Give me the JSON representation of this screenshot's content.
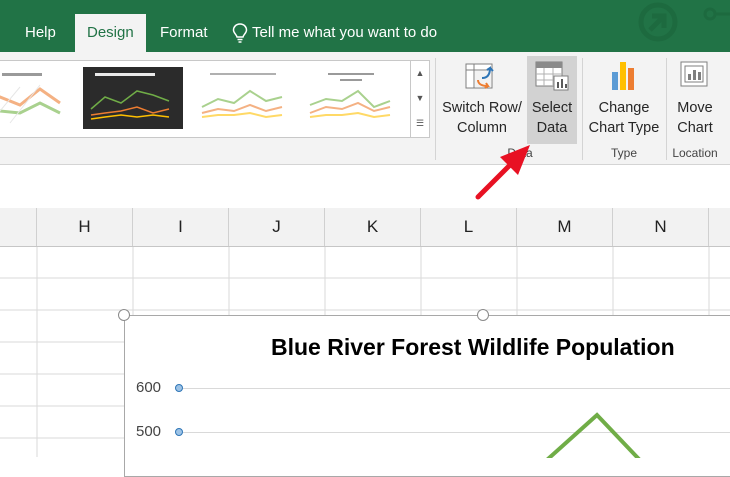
{
  "tabs": [
    {
      "label": "Help",
      "active": false
    },
    {
      "label": "Design",
      "active": true
    },
    {
      "label": "Format",
      "active": false
    }
  ],
  "tell_me": "Tell me what you want to do",
  "ribbon": {
    "switch_row_column": {
      "line1": "Switch Row/",
      "line2": "Column"
    },
    "select_data": {
      "line1": "Select",
      "line2": "Data"
    },
    "change_chart_type": {
      "line1": "Change",
      "line2": "Chart Type"
    },
    "move_chart": {
      "line1": "Move",
      "line2": "Chart"
    },
    "groups": {
      "data": "Data",
      "type": "Type",
      "location": "Location"
    }
  },
  "columns": [
    "H",
    "I",
    "J",
    "K",
    "L",
    "M",
    "N"
  ],
  "chart": {
    "title": "Blue River Forest Wildlife Population",
    "y_ticks": [
      "600",
      "500"
    ]
  },
  "colors": {
    "excel_green": "#217346",
    "series_green": "#70ad47",
    "arrow_red": "#e81123"
  }
}
